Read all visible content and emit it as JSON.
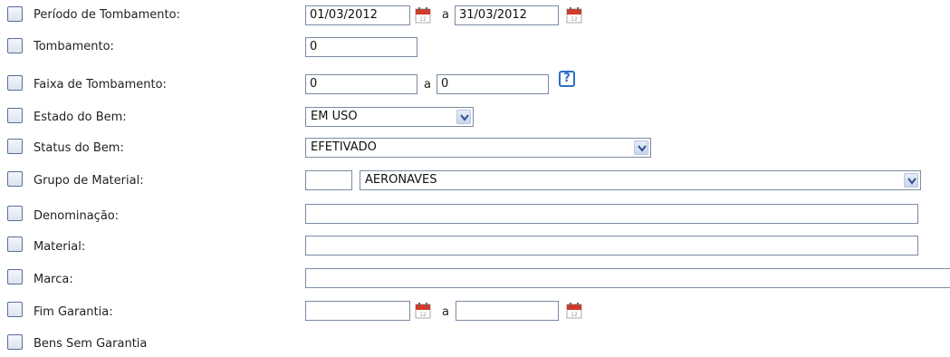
{
  "fields": {
    "periodo": {
      "label": "Período de Tombamento:",
      "from": "01/03/2012",
      "sep": "a",
      "to": "31/03/2012"
    },
    "tombamento": {
      "label": "Tombamento:",
      "value": "0"
    },
    "faixa": {
      "label": "Faixa de Tombamento:",
      "from": "0",
      "sep": "a",
      "to": "0",
      "help": "?"
    },
    "estado": {
      "label": "Estado do Bem:",
      "selected": "EM USO"
    },
    "status": {
      "label": "Status do Bem:",
      "selected": "EFETIVADO"
    },
    "grupo": {
      "label": "Grupo de Material:",
      "code": "",
      "selected": "AERONAVES"
    },
    "denominacao": {
      "label": "Denominação:",
      "value": ""
    },
    "material": {
      "label": "Material:",
      "value": ""
    },
    "marca": {
      "label": "Marca:",
      "value": ""
    },
    "fim_garantia": {
      "label": "Fim Garantia:",
      "from": "",
      "sep": "a",
      "to": ""
    },
    "sem_garantia": {
      "label": "Bens Sem Garantia"
    }
  },
  "icons": {
    "calendar": "calendar-icon",
    "dropdown": "chevron-down-icon",
    "help": "help-icon"
  },
  "colors": {
    "input_border": "#7b8aa3",
    "calendar_red": "#d23a2a",
    "help_blue": "#2d6fc3"
  }
}
